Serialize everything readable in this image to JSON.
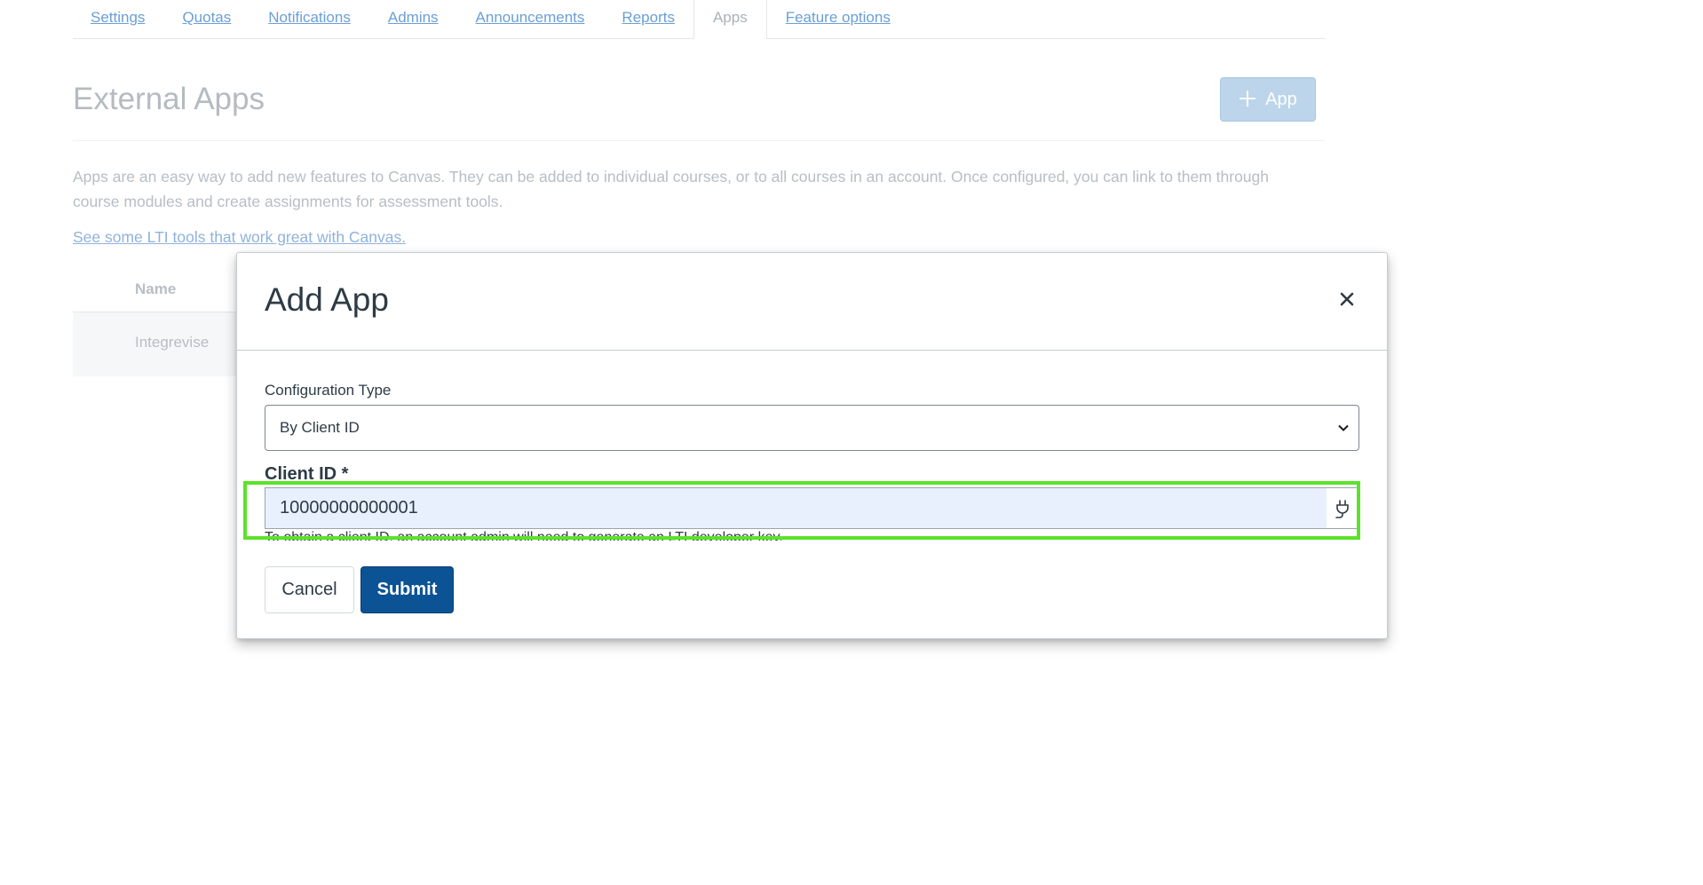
{
  "tabs": [
    {
      "label": "Settings"
    },
    {
      "label": "Quotas"
    },
    {
      "label": "Notifications"
    },
    {
      "label": "Admins"
    },
    {
      "label": "Announcements"
    },
    {
      "label": "Reports"
    },
    {
      "label": "Apps",
      "active": true
    },
    {
      "label": "Feature options"
    }
  ],
  "header": {
    "title": "External Apps",
    "add_button_label": "App"
  },
  "description": "Apps are an easy way to add new features to Canvas. They can be added to individual courses, or to all courses in an account. Once configured, you can link to them through course modules and create assignments for assessment tools.",
  "lti_link": "See some LTI tools that work great with Canvas.",
  "table": {
    "header_name": "Name",
    "rows": [
      {
        "name": "Integrevise"
      }
    ]
  },
  "modal": {
    "title": "Add App",
    "config_type_label": "Configuration Type",
    "config_type_value": "By Client ID",
    "client_id_label": "Client ID *",
    "client_id_value": "10000000000001",
    "client_id_hint": "To obtain a client ID, an account admin will need to generate an LTI developer key.",
    "cancel_label": "Cancel",
    "submit_label": "Submit"
  },
  "colors": {
    "highlight": "#5be22a",
    "submit_bg": "#0b5394",
    "input_autofill_bg": "#e8f0fe"
  }
}
